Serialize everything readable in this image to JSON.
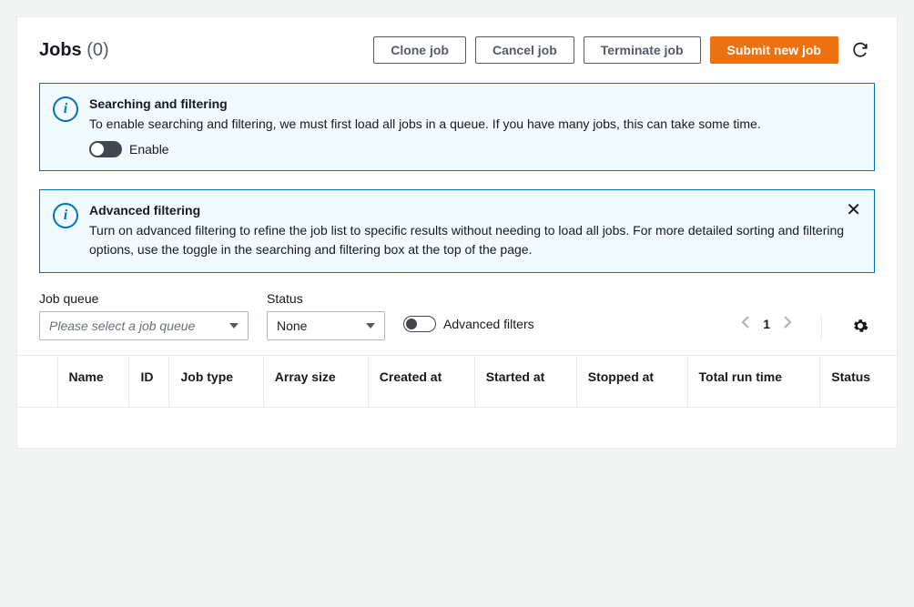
{
  "header": {
    "title": "Jobs",
    "count_display": "(0)",
    "actions": {
      "clone": "Clone job",
      "cancel": "Cancel job",
      "terminate": "Terminate job",
      "submit": "Submit new job"
    }
  },
  "info1": {
    "title": "Searching and filtering",
    "body": "To enable searching and filtering, we must first load all jobs in a queue. If you have many jobs, this can take some time.",
    "toggle_label": "Enable"
  },
  "info2": {
    "title": "Advanced filtering",
    "body": "Turn on advanced filtering to refine the job list to specific results without needing to load all jobs. For more detailed sorting and filtering options, use the toggle in the searching and filtering box at the top of the page."
  },
  "filters": {
    "queue_label": "Job queue",
    "queue_placeholder": "Please select a job queue",
    "status_label": "Status",
    "status_value": "None",
    "advanced_label": "Advanced filters"
  },
  "pager": {
    "page": "1"
  },
  "columns": {
    "name": "Name",
    "id": "ID",
    "job_type": "Job type",
    "array_size": "Array size",
    "created_at": "Created at",
    "started_at": "Started at",
    "stopped_at": "Stopped at",
    "total_run_time": "Total run time",
    "status": "Status"
  }
}
